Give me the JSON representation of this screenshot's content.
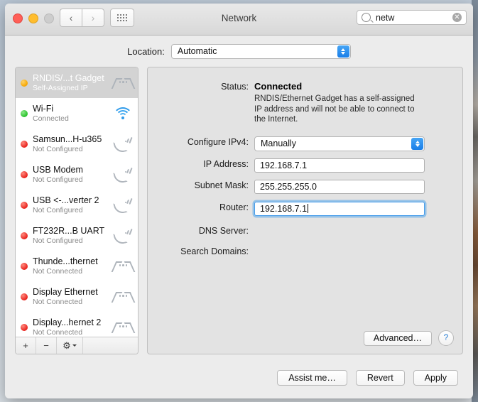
{
  "window": {
    "title": "Network"
  },
  "titlebar": {
    "back_label": "‹",
    "forward_label": "›",
    "grid_name": "show-all-icon"
  },
  "search": {
    "value": "netw",
    "placeholder": "Search",
    "clear_label": "✕"
  },
  "location": {
    "label": "Location:",
    "value": "Automatic"
  },
  "sidebar": {
    "items": [
      {
        "name": "RNDIS/...t Gadget",
        "status": "Self-Assigned IP",
        "dot": "amber",
        "icon": "ethernet-icon",
        "selected": true
      },
      {
        "name": "Wi-Fi",
        "status": "Connected",
        "dot": "green",
        "icon": "wifi-icon",
        "selected": false
      },
      {
        "name": "Samsun...H-u365",
        "status": "Not Configured",
        "dot": "red",
        "icon": "modem-icon",
        "selected": false
      },
      {
        "name": "USB Modem",
        "status": "Not Configured",
        "dot": "red",
        "icon": "modem-icon",
        "selected": false
      },
      {
        "name": "USB <-...verter 2",
        "status": "Not Configured",
        "dot": "red",
        "icon": "modem-icon",
        "selected": false
      },
      {
        "name": "FT232R...B UART",
        "status": "Not Configured",
        "dot": "red",
        "icon": "modem-icon",
        "selected": false
      },
      {
        "name": "Thunde...thernet",
        "status": "Not Connected",
        "dot": "red",
        "icon": "ethernet-icon",
        "selected": false
      },
      {
        "name": "Display Ethernet",
        "status": "Not Connected",
        "dot": "red",
        "icon": "ethernet-icon",
        "selected": false
      },
      {
        "name": "Display...hernet 2",
        "status": "Not Connected",
        "dot": "red",
        "icon": "ethernet-icon",
        "selected": false
      }
    ],
    "footer": {
      "add_label": "+",
      "remove_label": "−",
      "gear_label": "⚙"
    }
  },
  "detail": {
    "status_label": "Status:",
    "status_value": "Connected",
    "status_note": "RNDIS/Ethernet Gadget has a self-assigned IP address and will not be able to connect to the Internet.",
    "configure_label": "Configure IPv4:",
    "configure_value": "Manually",
    "ip_label": "IP Address:",
    "ip_value": "192.168.7.1",
    "subnet_label": "Subnet Mask:",
    "subnet_value": "255.255.255.0",
    "router_label": "Router:",
    "router_value": "192.168.7.1",
    "dns_label": "DNS Server:",
    "dns_value": "",
    "search_domains_label": "Search Domains:",
    "search_domains_value": "",
    "advanced_label": "Advanced…",
    "help_label": "?"
  },
  "footer": {
    "assist_label": "Assist me…",
    "revert_label": "Revert",
    "apply_label": "Apply"
  },
  "colors": {
    "accent_blue": "#1a7ee8",
    "status_green": "#28c22a",
    "status_red": "#e8211c",
    "status_amber": "#f4a500"
  }
}
